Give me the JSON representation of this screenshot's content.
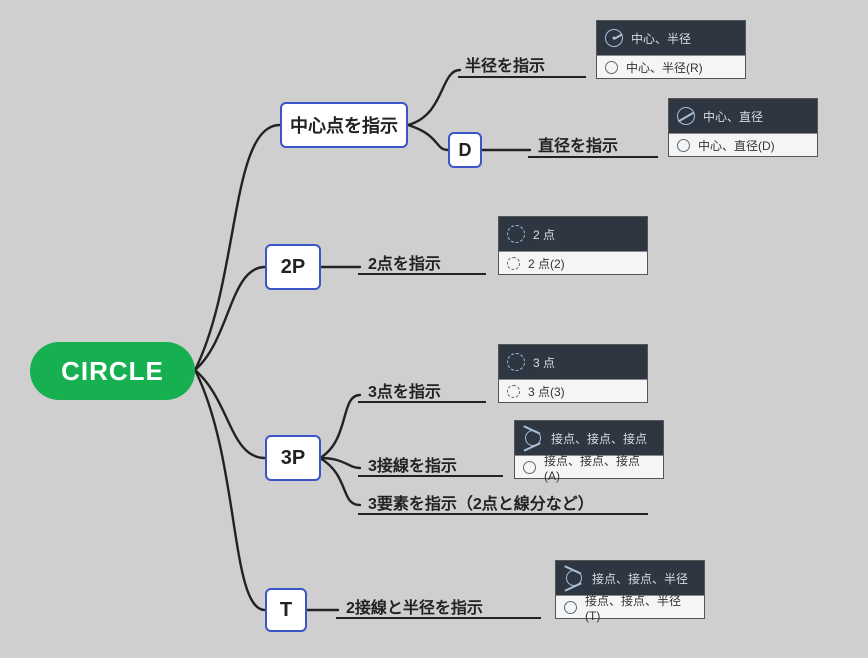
{
  "root": {
    "label": "CIRCLE"
  },
  "branches": {
    "center": {
      "label": "中心点を指示",
      "sub": {
        "radius": {
          "label": "半径を指示"
        },
        "diameter": {
          "key": "D",
          "label": "直径を指示"
        }
      }
    },
    "p2": {
      "key": "2P",
      "label": "2点を指示"
    },
    "p3": {
      "key": "3P",
      "sub": {
        "points": {
          "label": "3点を指示"
        },
        "tangents": {
          "label": "3接線を指示"
        },
        "elements": {
          "label": "3要素を指示（2点と線分など）"
        }
      }
    },
    "t": {
      "key": "T",
      "label": "2接線と半径を指示"
    }
  },
  "ui": {
    "center_radius": {
      "dark": "中心、半径",
      "light": "中心、半径(R)"
    },
    "center_diameter": {
      "dark": "中心、直径",
      "light": "中心、直径(D)"
    },
    "two_point": {
      "dark": "2 点",
      "light": "2 点(2)"
    },
    "three_point": {
      "dark": "3 点",
      "light": "3 点(3)"
    },
    "ttt": {
      "dark": "接点、接点、接点",
      "light": "接点、接点、接点(A)"
    },
    "ttr": {
      "dark": "接点、接点、半径",
      "light": "接点、接点、半径(T)"
    }
  }
}
